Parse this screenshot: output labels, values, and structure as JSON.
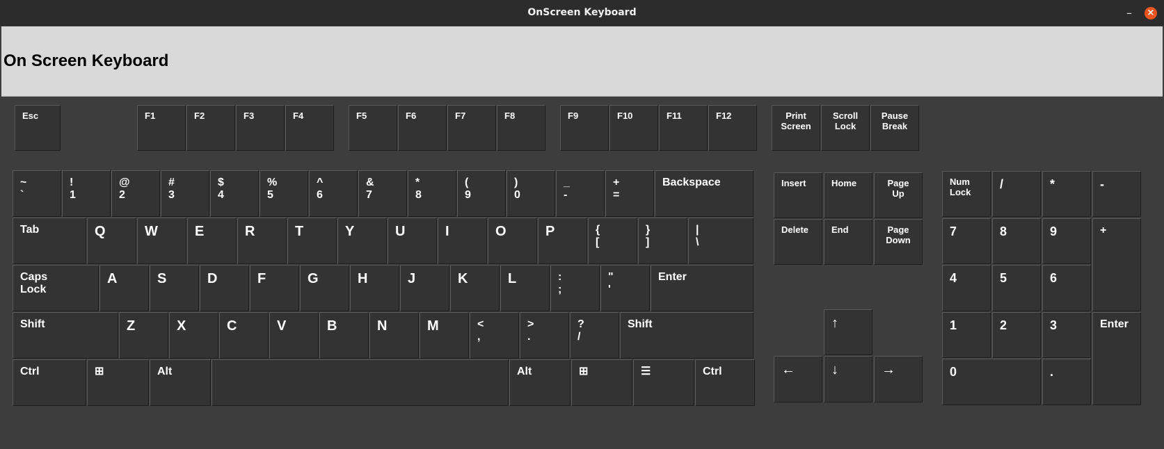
{
  "window": {
    "title": "OnScreen Keyboard",
    "minimize_label": "–",
    "close_label": "×"
  },
  "header": {
    "title": "On Screen Keyboard"
  },
  "keys": {
    "esc": "Esc",
    "f1": "F1",
    "f2": "F2",
    "f3": "F3",
    "f4": "F4",
    "f5": "F5",
    "f6": "F6",
    "f7": "F7",
    "f8": "F8",
    "f9": "F9",
    "f10": "F10",
    "f11": "F11",
    "f12": "F12",
    "print_screen": "Print\nScreen",
    "scroll_lock": "Scroll\nLock",
    "pause_break": "Pause\nBreak",
    "backtick": "~\n`",
    "digit_1": "!\n1",
    "digit_2": "@\n2",
    "digit_3": "#\n3",
    "digit_4": "$\n4",
    "digit_5": "%\n5",
    "digit_6": "^\n6",
    "digit_7": "&\n7",
    "digit_8": "*\n8",
    "digit_9": "(\n9",
    "digit_0": ")\n0",
    "minus": "_\n-",
    "equals": "+\n=",
    "backspace": "Backspace",
    "tab": "Tab",
    "q": "Q",
    "w": "W",
    "e": "E",
    "r": "R",
    "t": "T",
    "y": "Y",
    "u": "U",
    "i": "I",
    "o": "O",
    "p": "P",
    "bracket_left": "{\n[",
    "bracket_right": "}\n]",
    "backslash": "|\n\\",
    "caps_lock": "Caps\nLock",
    "a": "A",
    "s": "S",
    "d": "D",
    "f": "F",
    "g": "G",
    "h": "H",
    "j": "J",
    "k": "K",
    "l": "L",
    "semicolon": ":\n;",
    "quote": "\"\n'",
    "enter": "Enter",
    "shift_left": "Shift",
    "z": "Z",
    "x": "X",
    "c": "C",
    "v": "V",
    "b": "B",
    "n": "N",
    "m": "M",
    "comma": "<\n,",
    "period": ">\n.",
    "slash": "?\n/",
    "shift_right": "Shift",
    "ctrl_left": "Ctrl",
    "win_left": "⊞",
    "alt_left": "Alt",
    "space": "",
    "alt_right": "Alt",
    "win_right": "⊞",
    "menu": "☰",
    "ctrl_right": "Ctrl",
    "insert": "Insert",
    "home": "Home",
    "page_up": "Page\nUp",
    "delete": "Delete",
    "end": "End",
    "page_down": "Page\nDown",
    "arrow_up": "↑",
    "arrow_left": "←",
    "arrow_down": "↓",
    "arrow_right": "→",
    "num_lock": "Num\nLock",
    "num_divide": "/",
    "num_multiply": "*",
    "num_minus": "-",
    "num_7": "7",
    "num_8": "8",
    "num_9": "9",
    "num_plus": "+",
    "num_4": "4",
    "num_5": "5",
    "num_6": "6",
    "num_1": "1",
    "num_2": "2",
    "num_3": "3",
    "num_enter": "Enter",
    "num_0": "0",
    "num_decimal": "."
  }
}
